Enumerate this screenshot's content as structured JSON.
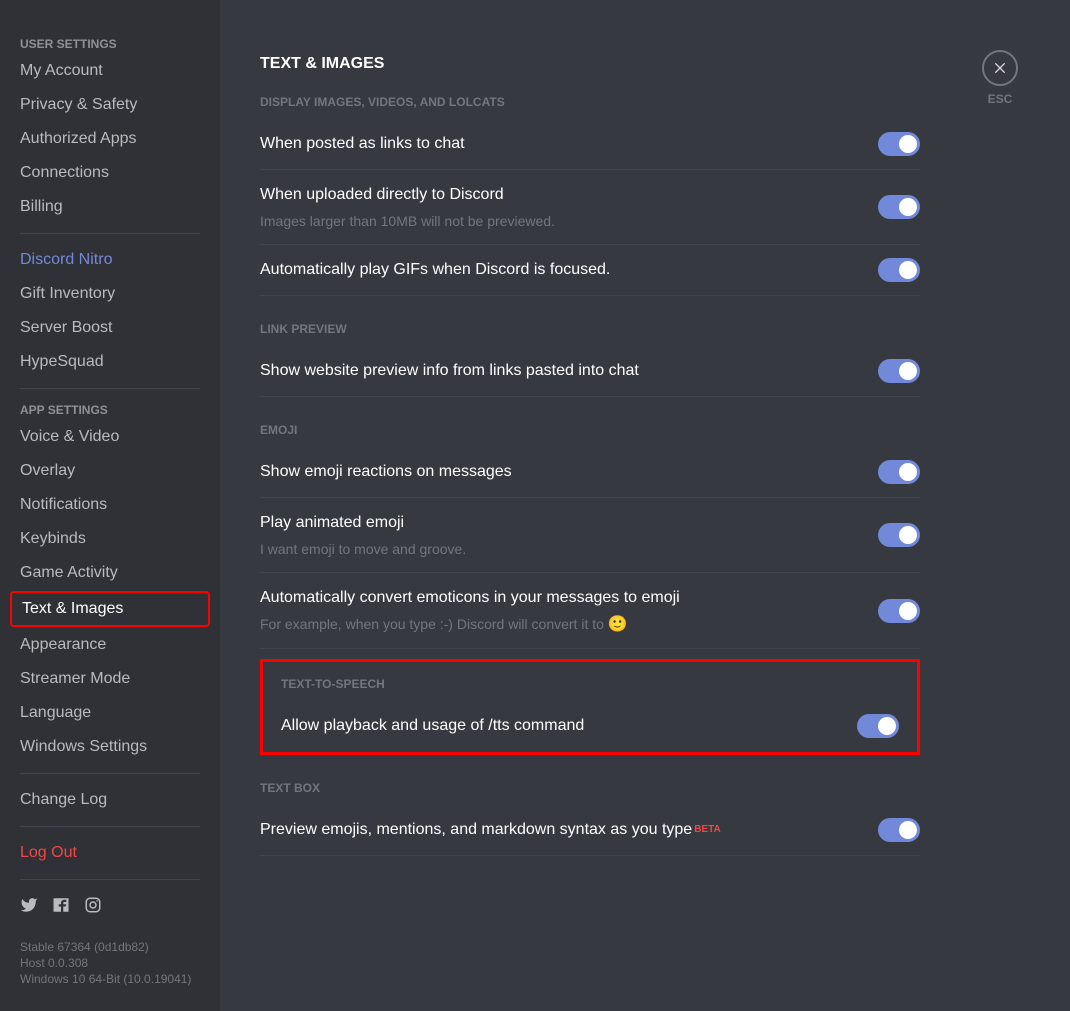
{
  "sidebar": {
    "user_settings_header": "USER SETTINGS",
    "user_settings_items": [
      "My Account",
      "Privacy & Safety",
      "Authorized Apps",
      "Connections",
      "Billing"
    ],
    "nitro_items": [
      "Discord Nitro",
      "Gift Inventory",
      "Server Boost",
      "HypeSquad"
    ],
    "app_settings_header": "APP SETTINGS",
    "app_settings_items": [
      "Voice & Video",
      "Overlay",
      "Notifications",
      "Keybinds",
      "Game Activity",
      "Text & Images",
      "Appearance",
      "Streamer Mode",
      "Language",
      "Windows Settings"
    ],
    "change_log": "Change Log",
    "log_out": "Log Out",
    "footer_lines": [
      "Stable 67364 (0d1db82)",
      "Host 0.0.308",
      "Windows 10 64-Bit (10.0.19041)"
    ]
  },
  "close": {
    "label": "ESC"
  },
  "page": {
    "title": "TEXT & IMAGES",
    "sections": {
      "display": {
        "header": "DISPLAY IMAGES, VIDEOS, AND LOLCATS",
        "posted_links": {
          "title": "When posted as links to chat"
        },
        "uploaded": {
          "title": "When uploaded directly to Discord",
          "desc": "Images larger than 10MB will not be previewed."
        },
        "auto_gif": {
          "title": "Automatically play GIFs when Discord is focused."
        }
      },
      "link_preview": {
        "header": "LINK PREVIEW",
        "show_preview": {
          "title": "Show website preview info from links pasted into chat"
        }
      },
      "emoji": {
        "header": "EMOJI",
        "show_reactions": {
          "title": "Show emoji reactions on messages"
        },
        "play_animated": {
          "title": "Play animated emoji",
          "desc": "I want emoji to move and groove."
        },
        "auto_convert": {
          "title": "Automatically convert emoticons in your messages to emoji",
          "desc": "For example, when you type :-) Discord will convert it to "
        }
      },
      "tts": {
        "header": "TEXT-TO-SPEECH",
        "allow": {
          "title": "Allow playback and usage of /tts command"
        }
      },
      "text_box": {
        "header": "TEXT BOX",
        "preview": {
          "title": "Preview emojis, mentions, and markdown syntax as you type",
          "badge": "BETA"
        }
      }
    }
  }
}
